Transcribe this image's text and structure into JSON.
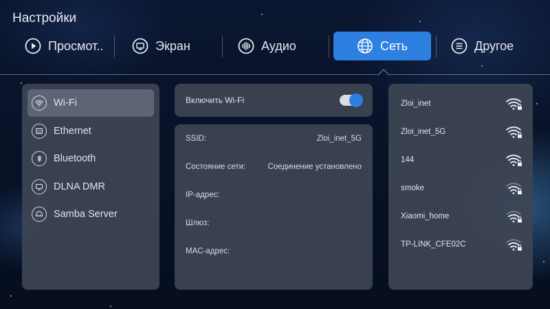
{
  "app": {
    "title": "Настройки"
  },
  "tabs": [
    {
      "label": "Просмот..",
      "icon": "play-icon"
    },
    {
      "label": "Экран",
      "icon": "monitor-icon"
    },
    {
      "label": "Аудио",
      "icon": "audio-wave-icon"
    },
    {
      "label": "Сеть",
      "icon": "globe-icon",
      "active": true
    },
    {
      "label": "Другое",
      "icon": "menu-icon"
    }
  ],
  "sidebar": {
    "items": [
      {
        "label": "Wi-Fi",
        "icon": "wifi-icon",
        "active": true
      },
      {
        "label": "Ethernet",
        "icon": "ethernet-icon"
      },
      {
        "label": "Bluetooth",
        "icon": "bluetooth-icon"
      },
      {
        "label": "DLNA DMR",
        "icon": "dlna-icon"
      },
      {
        "label": "Samba Server",
        "icon": "samba-icon"
      }
    ]
  },
  "wifi_toggle": {
    "label": "Включить Wi-Fi",
    "enabled": true
  },
  "info": [
    {
      "label": "SSID:",
      "value": "Zloi_inet_5G"
    },
    {
      "label": "Состояние сети:",
      "value": "Соединение установлено"
    },
    {
      "label": "IP-адрес:",
      "value": ""
    },
    {
      "label": "Шлюз:",
      "value": ""
    },
    {
      "label": "MAC-адрес:",
      "value": ""
    }
  ],
  "networks": [
    {
      "name": "Zloi_inet",
      "locked": true
    },
    {
      "name": "Zloi_inet_5G",
      "locked": true
    },
    {
      "name": "144",
      "locked": true
    },
    {
      "name": "smoke",
      "locked": true
    },
    {
      "name": "Xiaomi_home",
      "locked": true
    },
    {
      "name": "TP-LINK_CFE02C",
      "locked": true
    }
  ],
  "colors": {
    "accent": "#2d7fe0",
    "panel": "#3e4454",
    "background": "#081226"
  }
}
